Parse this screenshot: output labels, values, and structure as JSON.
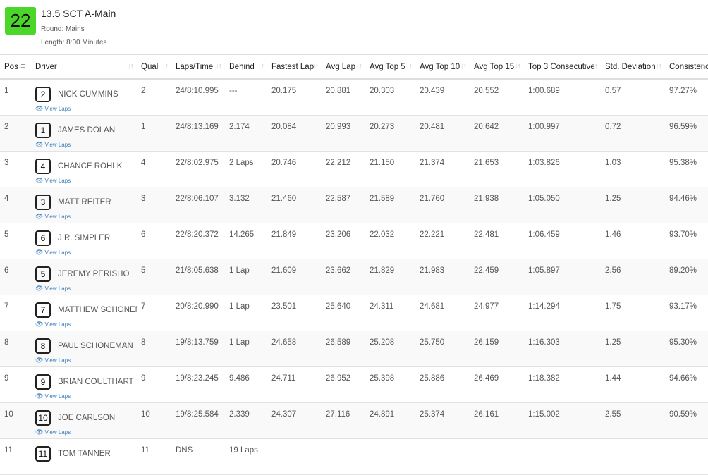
{
  "race": {
    "heat_number": "22",
    "title": "13.5 SCT A-Main",
    "round": "Round: Mains",
    "length": "Length: 8:00 Minutes"
  },
  "columns": [
    "Pos",
    "Driver",
    "Qual",
    "Laps/Time",
    "Behind",
    "Fastest Lap",
    "Avg Lap",
    "Avg Top 5",
    "Avg Top 10",
    "Avg Top 15",
    "Top 3 Consecutive",
    "Std. Deviation",
    "Consistency"
  ],
  "view_laps_label": "View Laps",
  "rows": [
    {
      "pos": "1",
      "car": "2",
      "driver": "NICK CUMMINS",
      "qual": "2",
      "laps": "24/8:10.995",
      "behind": "---",
      "fastest": "20.175",
      "avg": "20.881",
      "top5": "20.303",
      "top10": "20.439",
      "top15": "20.552",
      "top3c": "1:00.689",
      "std": "0.57",
      "consistency": "97.27%"
    },
    {
      "pos": "2",
      "car": "1",
      "driver": "JAMES DOLAN",
      "qual": "1",
      "laps": "24/8:13.169",
      "behind": "2.174",
      "fastest": "20.084",
      "avg": "20.993",
      "top5": "20.273",
      "top10": "20.481",
      "top15": "20.642",
      "top3c": "1:00.997",
      "std": "0.72",
      "consistency": "96.59%"
    },
    {
      "pos": "3",
      "car": "4",
      "driver": "CHANCE ROHLK",
      "qual": "4",
      "laps": "22/8:02.975",
      "behind": "2 Laps",
      "fastest": "20.746",
      "avg": "22.212",
      "top5": "21.150",
      "top10": "21.374",
      "top15": "21.653",
      "top3c": "1:03.826",
      "std": "1.03",
      "consistency": "95.38%"
    },
    {
      "pos": "4",
      "car": "3",
      "driver": "MATT REITER",
      "qual": "3",
      "laps": "22/8:06.107",
      "behind": "3.132",
      "fastest": "21.460",
      "avg": "22.587",
      "top5": "21.589",
      "top10": "21.760",
      "top15": "21.938",
      "top3c": "1:05.050",
      "std": "1.25",
      "consistency": "94.46%"
    },
    {
      "pos": "5",
      "car": "6",
      "driver": "J.R. SIMPLER",
      "qual": "6",
      "laps": "22/8:20.372",
      "behind": "14.265",
      "fastest": "21.849",
      "avg": "23.206",
      "top5": "22.032",
      "top10": "22.221",
      "top15": "22.481",
      "top3c": "1:06.459",
      "std": "1.46",
      "consistency": "93.70%"
    },
    {
      "pos": "6",
      "car": "5",
      "driver": "JEREMY PERISHO",
      "qual": "5",
      "laps": "21/8:05.638",
      "behind": "1 Lap",
      "fastest": "21.609",
      "avg": "23.662",
      "top5": "21.829",
      "top10": "21.983",
      "top15": "22.459",
      "top3c": "1:05.897",
      "std": "2.56",
      "consistency": "89.20%"
    },
    {
      "pos": "7",
      "car": "7",
      "driver": "MATTHEW SCHONEMAN",
      "qual": "7",
      "laps": "20/8:20.990",
      "behind": "1 Lap",
      "fastest": "23.501",
      "avg": "25.640",
      "top5": "24.311",
      "top10": "24.681",
      "top15": "24.977",
      "top3c": "1:14.294",
      "std": "1.75",
      "consistency": "93.17%"
    },
    {
      "pos": "8",
      "car": "8",
      "driver": "PAUL SCHONEMAN",
      "qual": "8",
      "laps": "19/8:13.759",
      "behind": "1 Lap",
      "fastest": "24.658",
      "avg": "26.589",
      "top5": "25.208",
      "top10": "25.750",
      "top15": "26.159",
      "top3c": "1:16.303",
      "std": "1.25",
      "consistency": "95.30%"
    },
    {
      "pos": "9",
      "car": "9",
      "driver": "BRIAN COULTHART",
      "qual": "9",
      "laps": "19/8:23.245",
      "behind": "9.486",
      "fastest": "24.711",
      "avg": "26.952",
      "top5": "25.398",
      "top10": "25.886",
      "top15": "26.469",
      "top3c": "1:18.382",
      "std": "1.44",
      "consistency": "94.66%"
    },
    {
      "pos": "10",
      "car": "10",
      "driver": "JOE CARLSON",
      "qual": "10",
      "laps": "19/8:25.584",
      "behind": "2.339",
      "fastest": "24.307",
      "avg": "27.116",
      "top5": "24.891",
      "top10": "25.374",
      "top15": "26.161",
      "top3c": "1:15.002",
      "std": "2.55",
      "consistency": "90.59%"
    },
    {
      "pos": "11",
      "car": "11",
      "driver": "TOM TANNER",
      "qual": "11",
      "laps": "DNS",
      "behind": "19 Laps",
      "fastest": "",
      "avg": "",
      "top5": "",
      "top10": "",
      "top15": "",
      "top3c": "",
      "std": "",
      "consistency": ""
    }
  ]
}
